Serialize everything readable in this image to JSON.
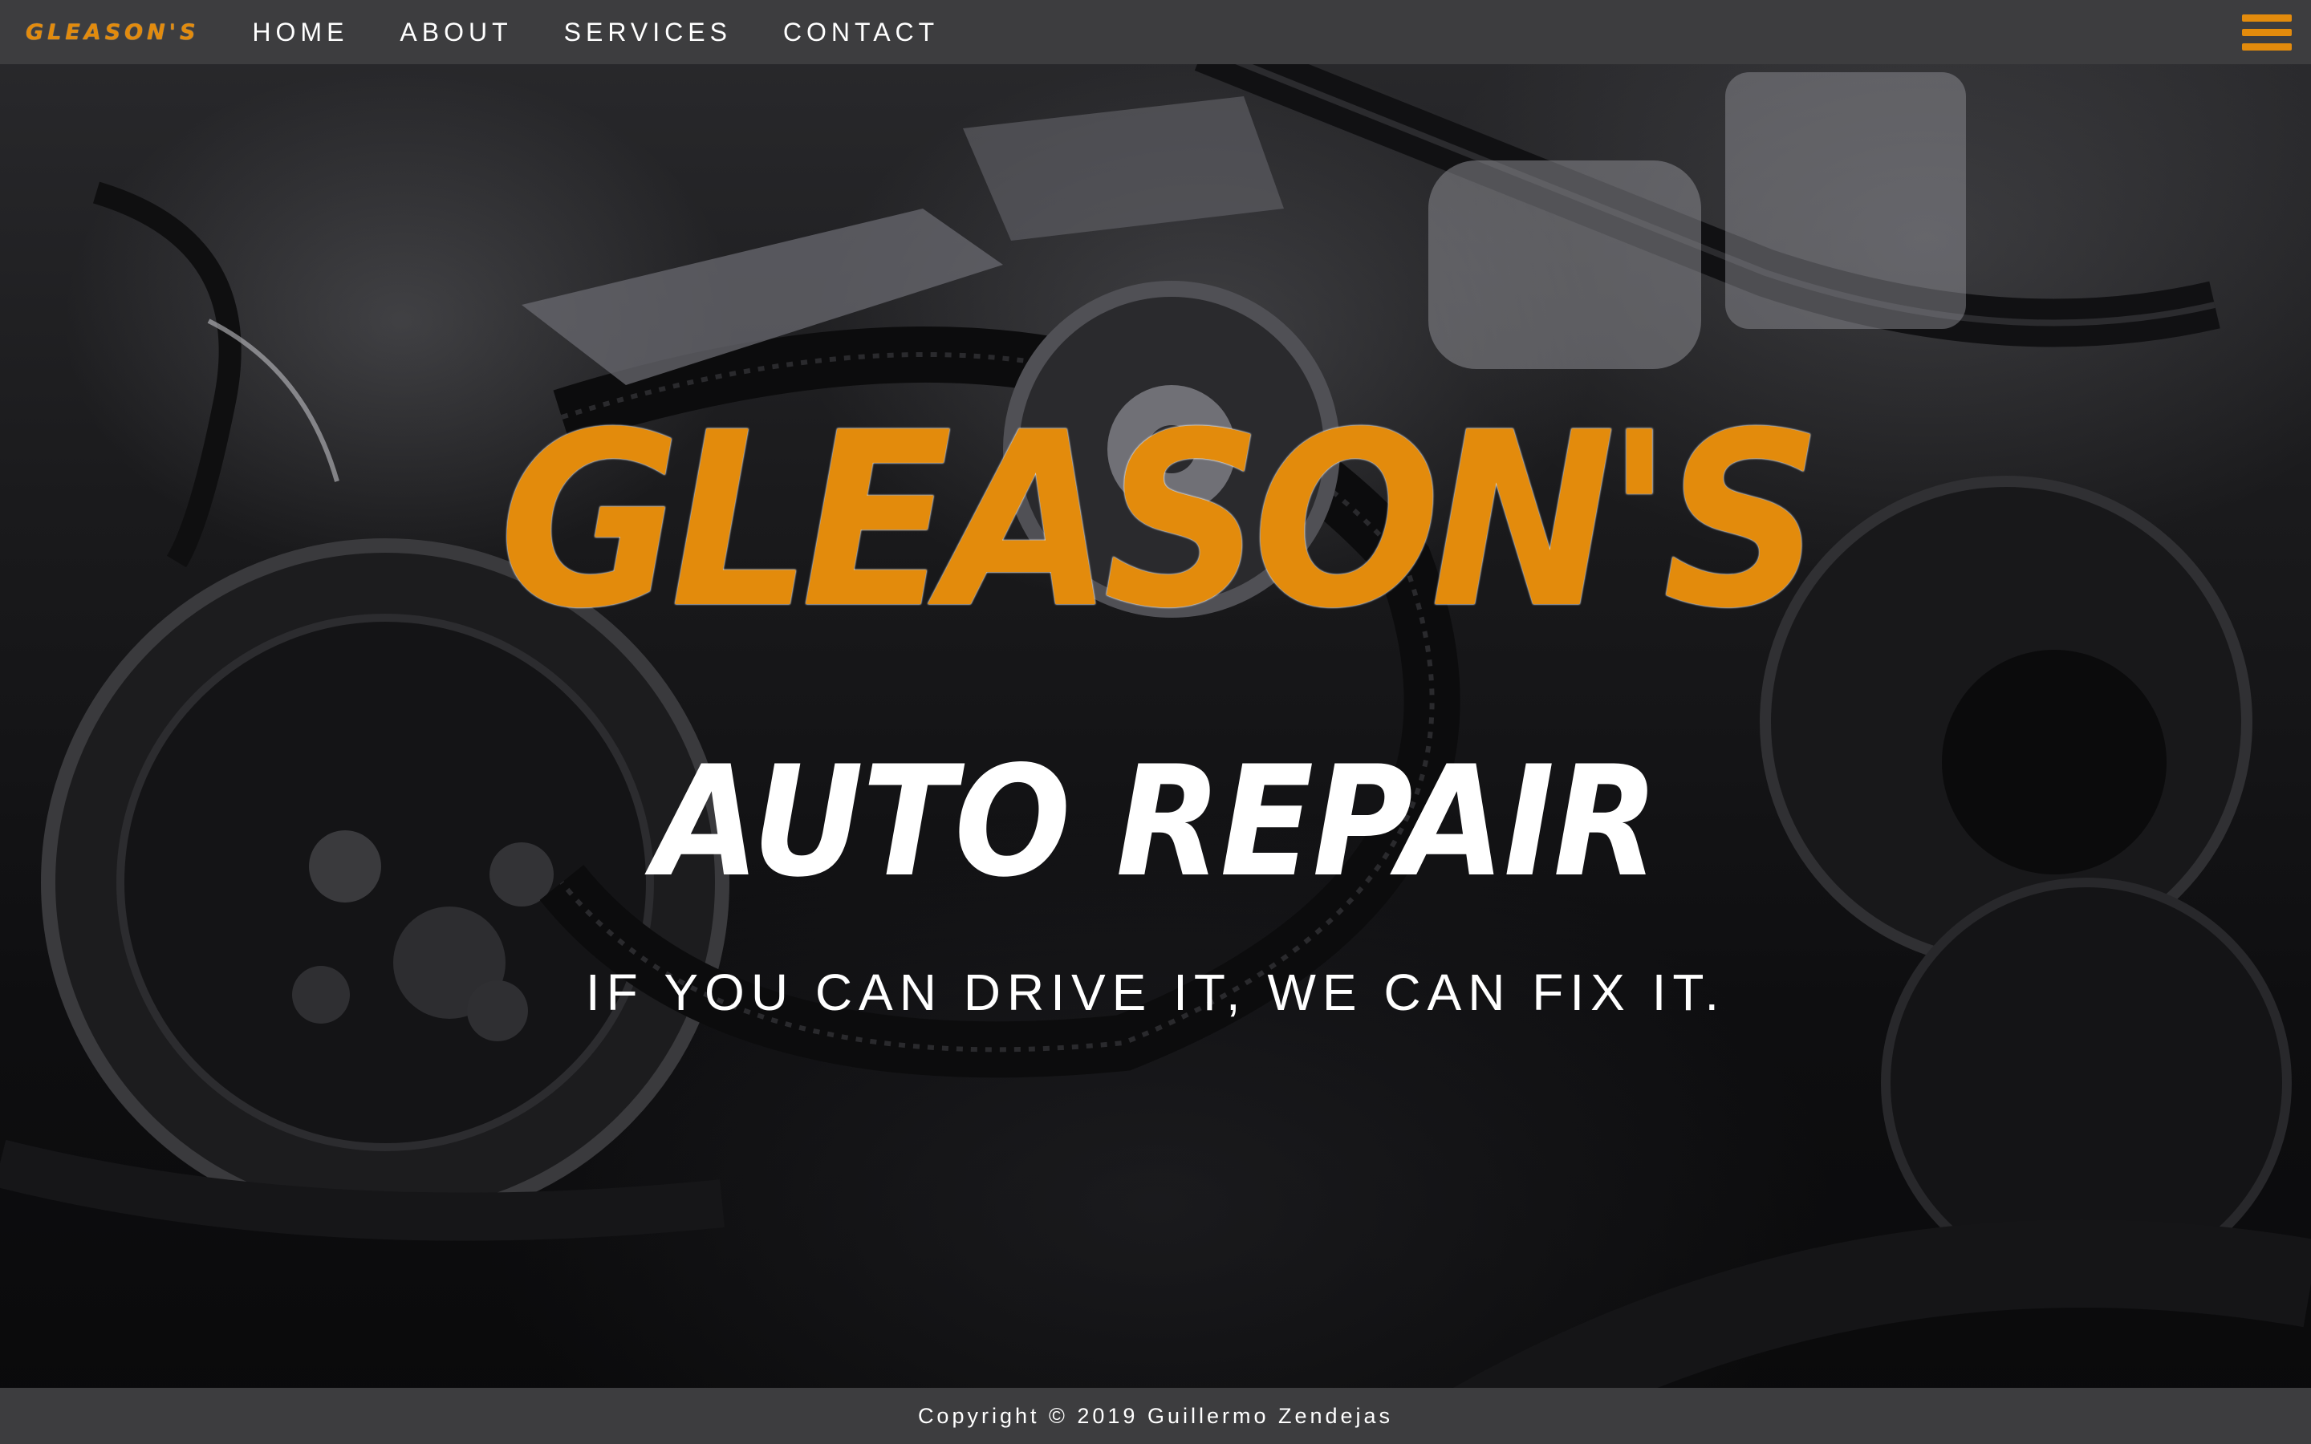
{
  "nav": {
    "logo": "GLEASON'S",
    "links": [
      {
        "label": "HOME"
      },
      {
        "label": "ABOUT"
      },
      {
        "label": "SERVICES"
      },
      {
        "label": "CONTACT"
      }
    ],
    "menu_icon": "hamburger-menu-icon"
  },
  "hero": {
    "title": "GLEASON'S",
    "subtitle": "AUTO REPAIR",
    "tagline": "IF YOU CAN DRIVE IT, WE CAN FIX IT.",
    "background_image": "engine-bay-photo"
  },
  "footer": {
    "copyright": "Copyright © 2019 Guillermo Zendejas"
  },
  "colors": {
    "accent": "#e38b0c",
    "bar": "#3d3d3f",
    "text": "#ffffff"
  }
}
